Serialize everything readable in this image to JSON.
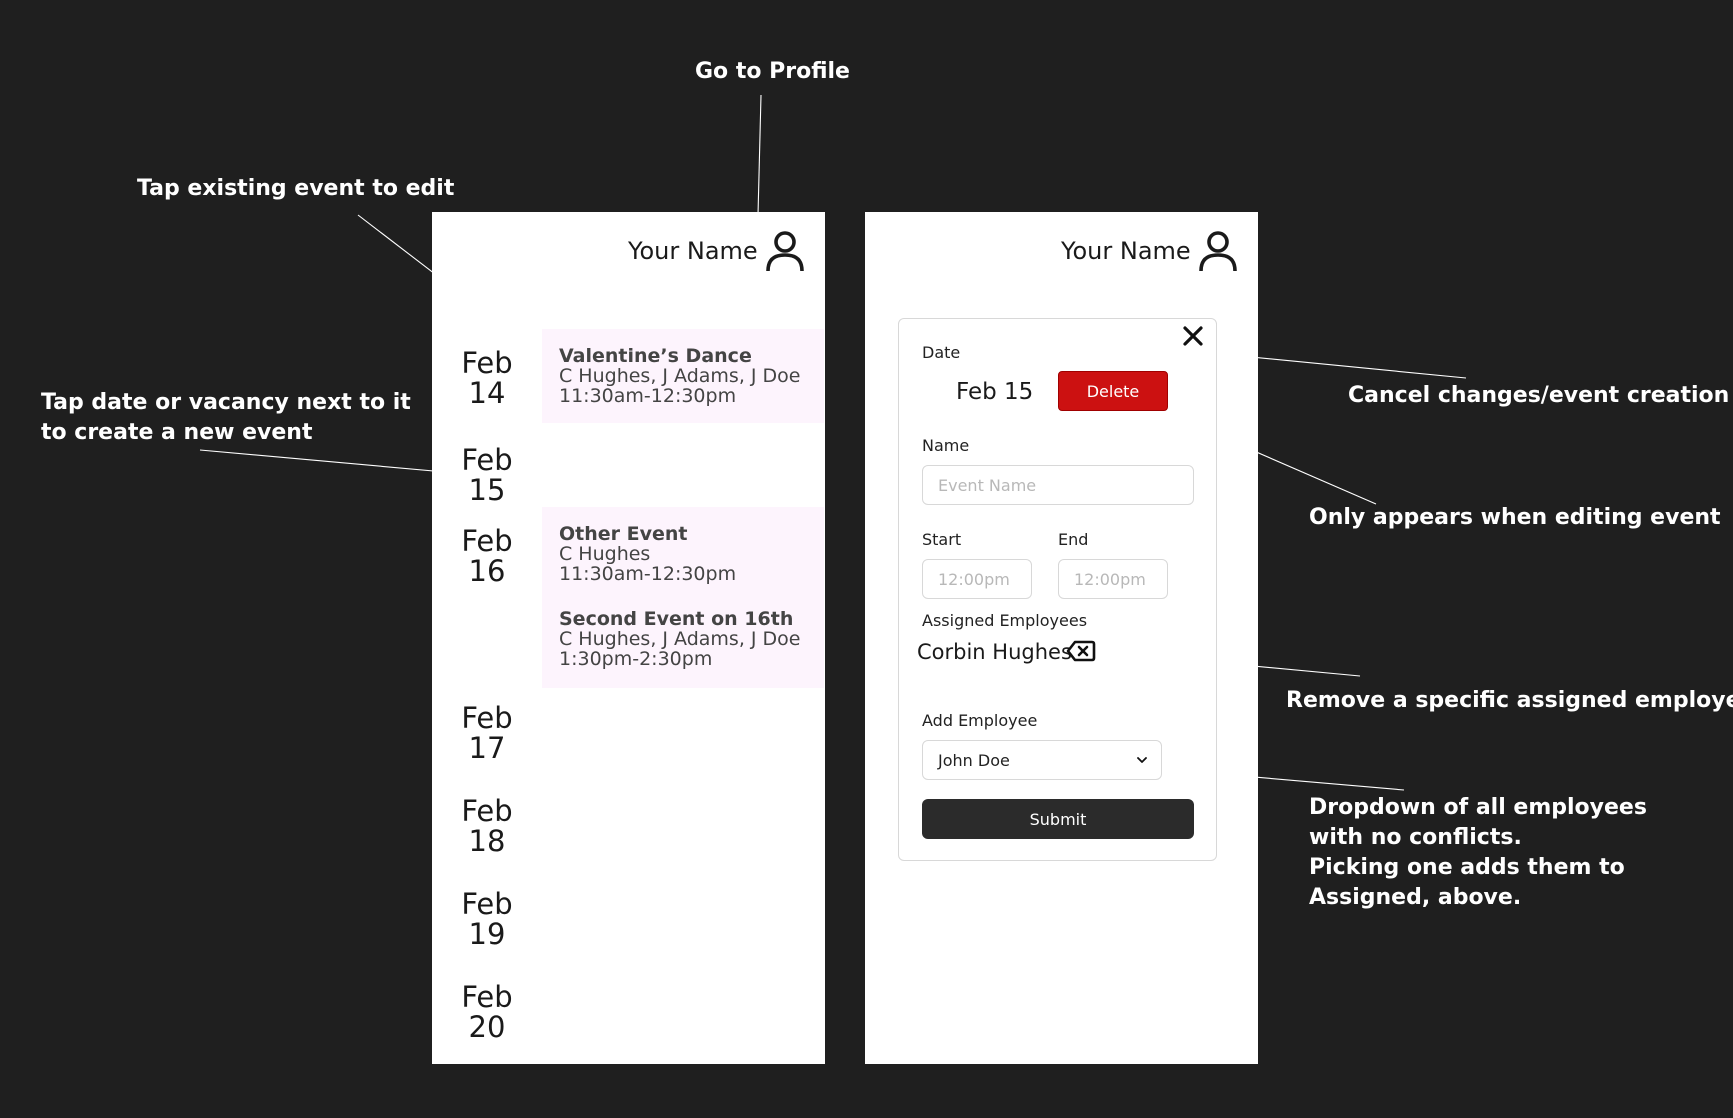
{
  "annotations": {
    "go_to_profile": "Go to Profile",
    "tap_existing": "Tap existing event to edit",
    "tap_date_line1": "Tap date or vacancy next to it",
    "tap_date_line2": "to create a new event",
    "cancel": "Cancel changes/event creation",
    "delete_note": "Only appears when editing event",
    "remove_note": "Remove a specific assigned employee",
    "dropdown_line1": "Dropdown of all employees",
    "dropdown_line2": "with no conflicts.",
    "dropdown_line3": "Picking one adds them to",
    "dropdown_line4": "Assigned, above."
  },
  "header": {
    "user_name": "Your Name",
    "icon": "person-icon"
  },
  "calendar": {
    "dates": [
      {
        "month": "Feb",
        "day": "14"
      },
      {
        "month": "Feb",
        "day": "15"
      },
      {
        "month": "Feb",
        "day": "16"
      },
      {
        "month": "Feb",
        "day": "17"
      },
      {
        "month": "Feb",
        "day": "18"
      },
      {
        "month": "Feb",
        "day": "19"
      },
      {
        "month": "Feb",
        "day": "20"
      }
    ],
    "events": [
      {
        "title": "Valentine’s Dance",
        "people": "C Hughes, J Adams, J Doe",
        "time": "11:30am-12:30pm"
      },
      {
        "title": "Other Event",
        "people": "C Hughes",
        "time": "11:30am-12:30pm"
      },
      {
        "title": "Second Event on 16th",
        "people": "C Hughes, J Adams, J Doe",
        "time": "1:30pm-2:30pm"
      }
    ]
  },
  "form": {
    "date_label": "Date",
    "date_value": "Feb 15",
    "delete_label": "Delete",
    "name_label": "Name",
    "name_placeholder": "Event Name",
    "start_label": "Start",
    "start_placeholder": "12:00pm",
    "end_label": "End",
    "end_placeholder": "12:00pm",
    "assigned_label": "Assigned Employees",
    "assigned_employee": "Corbin Hughes",
    "add_label": "Add Employee",
    "add_selected": "John Doe",
    "submit_label": "Submit"
  },
  "colors": {
    "background": "#1f1f1f",
    "event_block": "#fdf4fd",
    "delete": "#cc1111",
    "submit": "#2b2b2b"
  }
}
